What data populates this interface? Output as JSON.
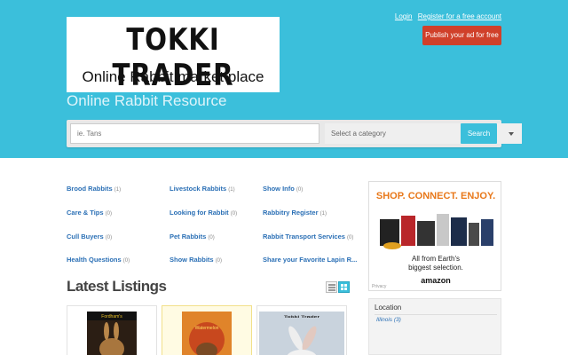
{
  "header": {
    "logo_title": "TOKKI TRADER",
    "logo_subtitle": "Online Rabbit market place",
    "tagline": "Online Rabbit Resource",
    "login_label": "Login",
    "register_label": "Register for a free account",
    "publish_label": "Publish your ad for free",
    "bg_color": "#3bbfdb",
    "publish_color": "#d0402a"
  },
  "search": {
    "placeholder": "ie. Tans",
    "category_value": "Select a category",
    "button_label": "Search"
  },
  "categories": [
    {
      "label": "Brood Rabbits",
      "count": "(1)"
    },
    {
      "label": "Care & Tips",
      "count": "(0)"
    },
    {
      "label": "Cull Buyers",
      "count": "(0)"
    },
    {
      "label": "Health Questions",
      "count": "(0)"
    },
    {
      "label": "Livestock Rabbits",
      "count": "(1)"
    },
    {
      "label": "Looking for Rabbit",
      "count": "(0)"
    },
    {
      "label": "Pet Rabbits",
      "count": "(0)"
    },
    {
      "label": "Show Rabbits",
      "count": "(0)"
    },
    {
      "label": "Show Info",
      "count": "(0)"
    },
    {
      "label": "Rabbitry Register",
      "count": "(1)"
    },
    {
      "label": "Rabbit Transport Services",
      "count": "(0)"
    },
    {
      "label": "Share your Favorite Lapin R...",
      "count": ""
    }
  ],
  "listings": {
    "title": "Latest Listings",
    "items": [
      {
        "thumb_label": "Fordham's"
      },
      {
        "thumb_label": "Watermelon"
      },
      {
        "thumb_label": "Tokki Trader"
      }
    ]
  },
  "ad": {
    "headline": "SHOP. CONNECT. ENJOY.",
    "line1": "All from Earth's",
    "line2": "biggest selection.",
    "brand": "amazon",
    "privacy": "Privacy"
  },
  "location": {
    "title": "Location",
    "item_label": "Illinois",
    "item_count": "(3)"
  }
}
